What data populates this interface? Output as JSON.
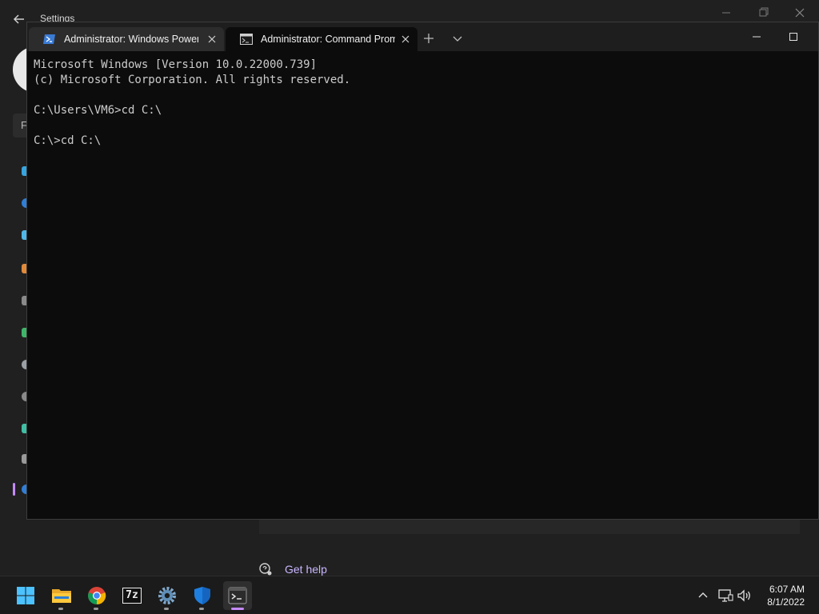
{
  "settings": {
    "title": "Settings",
    "search_label": "F",
    "help_label": "Get help"
  },
  "terminal": {
    "tabs": [
      {
        "label": "Administrator: Windows PowerShell",
        "icon": "powershell-icon",
        "active": false
      },
      {
        "label": "Administrator: Command Prompt",
        "icon": "cmd-icon",
        "active": true
      }
    ],
    "console_lines": [
      "Microsoft Windows [Version 10.0.22000.739]",
      "(c) Microsoft Corporation. All rights reserved.",
      "",
      "C:\\Users\\VM6>cd C:\\",
      "",
      "C:\\>cd C:\\"
    ]
  },
  "taskbar": {
    "apps": [
      {
        "name": "start-button",
        "icon": "windows-logo-icon"
      },
      {
        "name": "file-explorer",
        "icon": "folder-icon"
      },
      {
        "name": "chrome",
        "icon": "chrome-icon"
      },
      {
        "name": "7zip",
        "icon": "7zip-icon",
        "text": "7z"
      },
      {
        "name": "settings",
        "icon": "gear-icon"
      },
      {
        "name": "windows-security",
        "icon": "shield-icon"
      },
      {
        "name": "terminal",
        "icon": "terminal-icon"
      }
    ],
    "clock": {
      "time": "6:07 AM",
      "date": "8/1/2022"
    }
  },
  "colors": {
    "accent": "#c58af9",
    "terminal_bg": "#0c0c0c",
    "console_text": "#cccccc"
  }
}
